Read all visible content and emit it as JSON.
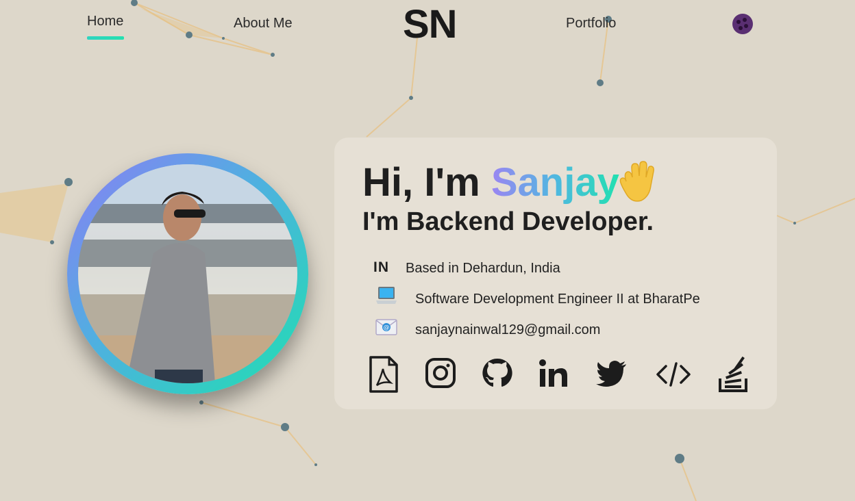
{
  "nav": {
    "home_label": "Home",
    "about_label": "About Me",
    "logo_text": "SN",
    "portfolio_label": "Portfolio",
    "theme_toggle_icon": "cookie-icon"
  },
  "hero": {
    "greeting": "Hi, I'm ",
    "name": "Sanjay",
    "wave_icon": "waving-hand-icon",
    "role": "I'm Backend Developer.",
    "country_code": "IN",
    "location": "Based in Dehardun, India",
    "job": "Software Development Engineer II at BharatPe",
    "email": "sanjaynainwal129@gmail.com"
  },
  "social_links": [
    "pdf-resume-icon",
    "instagram-icon",
    "github-icon",
    "linkedin-icon",
    "twitter-icon",
    "code-icon",
    "stackoverflow-icon"
  ],
  "colors": {
    "background": "#ddd7ca",
    "accent_gradient_start": "#9b85f2",
    "accent_gradient_end": "#22e0b0",
    "nav_underline": "#2fd4c0"
  }
}
